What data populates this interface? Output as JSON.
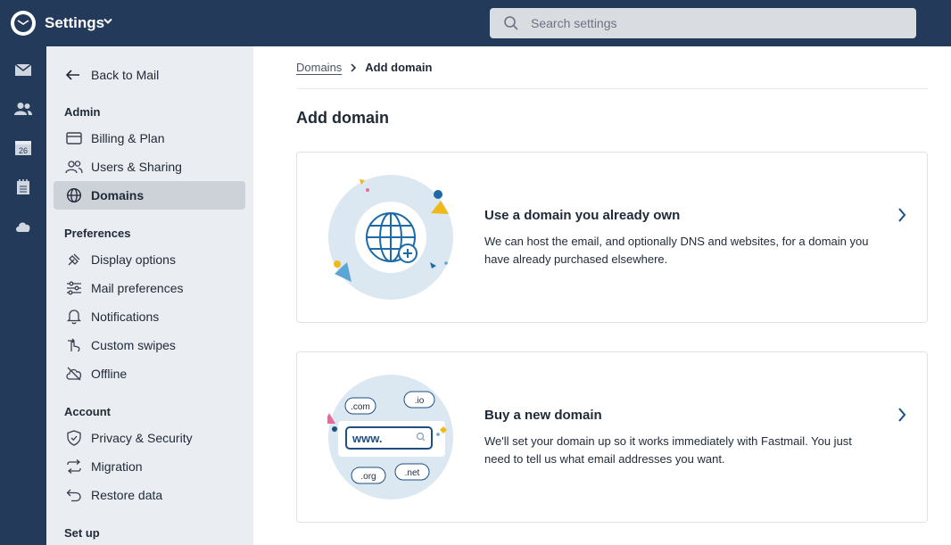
{
  "app": {
    "title": "Settings"
  },
  "search": {
    "placeholder": "Search settings",
    "value": ""
  },
  "rail": {
    "items": [
      {
        "icon": "mail-icon"
      },
      {
        "icon": "contacts-icon"
      },
      {
        "icon": "calendar-icon",
        "label": "26"
      },
      {
        "icon": "notes-icon"
      },
      {
        "icon": "cloud-icon"
      }
    ]
  },
  "sidebar": {
    "back_label": "Back to Mail",
    "sections": {
      "admin": "Admin",
      "preferences": "Preferences",
      "account": "Account",
      "setup": "Set up"
    },
    "items": {
      "billing": "Billing & Plan",
      "users": "Users & Sharing",
      "domains": "Domains",
      "display": "Display options",
      "mail_prefs": "Mail preferences",
      "notifications": "Notifications",
      "swipes": "Custom swipes",
      "offline": "Offline",
      "privacy": "Privacy & Security",
      "migration": "Migration",
      "restore": "Restore data"
    },
    "active_item": "domains"
  },
  "breadcrumb": {
    "parent": "Domains",
    "current": "Add domain"
  },
  "page": {
    "title": "Add domain"
  },
  "cards": [
    {
      "title": "Use a domain you already own",
      "description": "We can host the email, and optionally DNS and websites, for a domain you have already purchased elsewhere."
    },
    {
      "title": "Buy a new domain",
      "description": "We'll set your domain up so it works immediately with Fastmail. You just need to tell us what email addresses you want.",
      "illustration_labels": {
        "com": ".com",
        "io": ".io",
        "www": "www.",
        "org": ".org",
        "net": ".net"
      }
    }
  ],
  "colors": {
    "topbar": "#233a5b",
    "sidebar": "#eaedf1",
    "active_item": "#cdd2d9",
    "accent_blue": "#1d6aa8",
    "accent_yellow": "#f0b917"
  }
}
